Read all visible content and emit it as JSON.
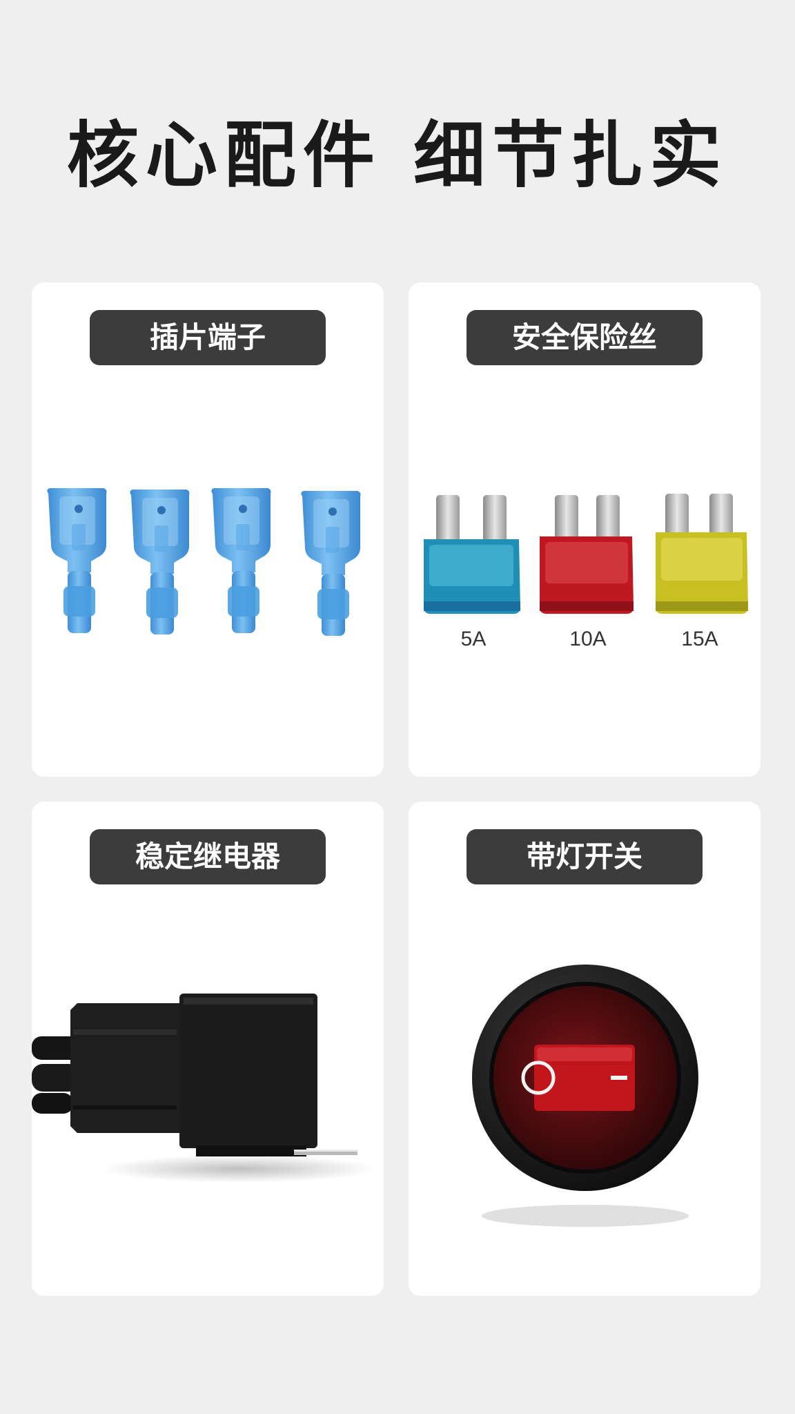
{
  "headline": "核心配件 细节扎实",
  "cards": [
    {
      "title": "插片端子"
    },
    {
      "title": "安全保险丝",
      "fuses": [
        "5A",
        "10A",
        "15A"
      ]
    },
    {
      "title": "稳定继电器"
    },
    {
      "title": "带灯开关"
    }
  ],
  "colors": {
    "page_bg": "#efeff0",
    "card_bg": "#ffffff",
    "pill_bg": "#3c3c3c",
    "terminal_blue": "#4a9ee0",
    "fuse_5a": "#1f8fb8",
    "fuse_10a": "#c01820",
    "fuse_15a": "#c8c020",
    "relay_black": "#1c1c1c",
    "switch_red": "#c0161c"
  },
  "icons": [
    "terminal-photo",
    "fuse-photo",
    "relay-photo",
    "rocker-switch-photo"
  ]
}
